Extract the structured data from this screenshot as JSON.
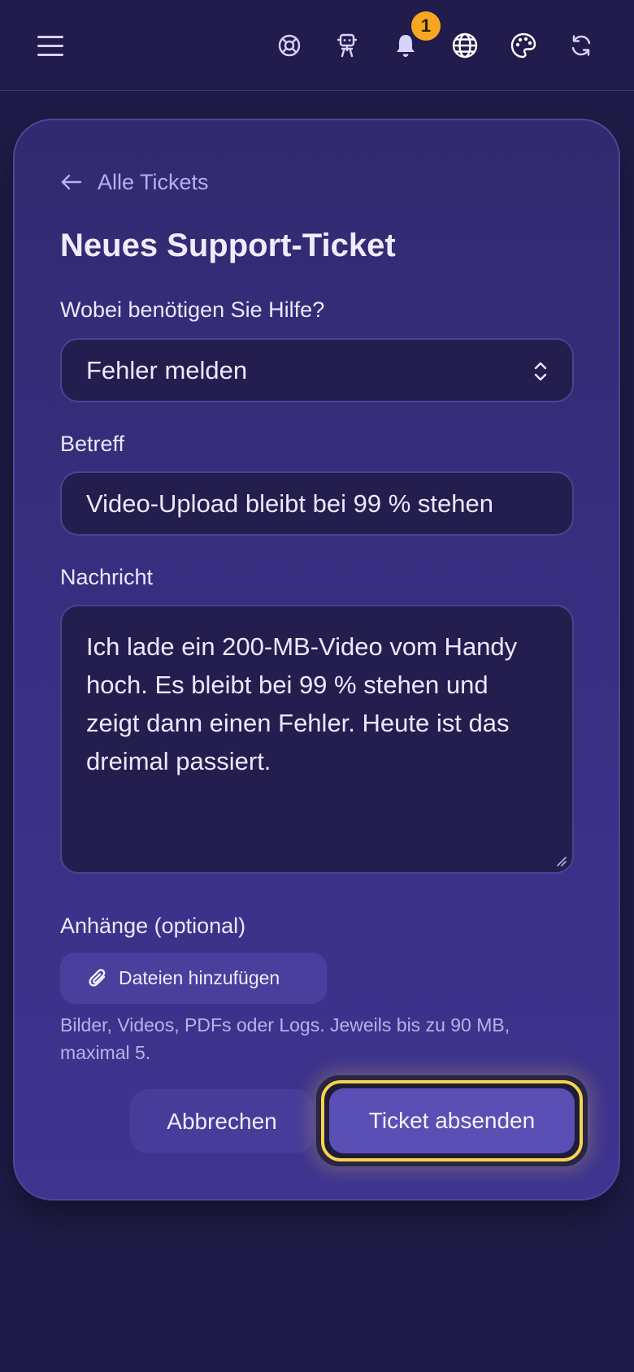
{
  "topbar": {
    "notification_count": "1",
    "icons": [
      "menu-icon",
      "lifebuoy-icon",
      "robot-icon",
      "bell-icon",
      "globe-icon",
      "palette-icon",
      "refresh-icon"
    ]
  },
  "form": {
    "back_label": "Alle Tickets",
    "title": "Neues Support-Ticket",
    "category_label": "Wobei benötigen Sie Hilfe?",
    "category_value": "Fehler melden",
    "subject_label": "Betreff",
    "subject_value": "Video-Upload bleibt bei 99 % stehen",
    "message_label": "Nachricht",
    "message_value": "Ich lade ein 200-MB-Video vom Handy hoch. Es bleibt bei 99 % stehen und zeigt dann einen Fehler. Heute ist das dreimal passiert.",
    "attachments_label": "Anhänge (optional)",
    "attach_button": "Dateien hinzufügen",
    "attachments_hint": "Bilder, Videos, PDFs oder Logs. Jeweils bis zu 90 MB, maximal 5.",
    "cancel_button": "Abbrechen",
    "submit_button": "Ticket absenden"
  },
  "colors": {
    "background": "#1f1b47",
    "card": "#392f82",
    "field": "#231e4d",
    "accent": "#5a4fb4",
    "focus_ring": "#f7d34a",
    "badge": "#f6a623"
  }
}
